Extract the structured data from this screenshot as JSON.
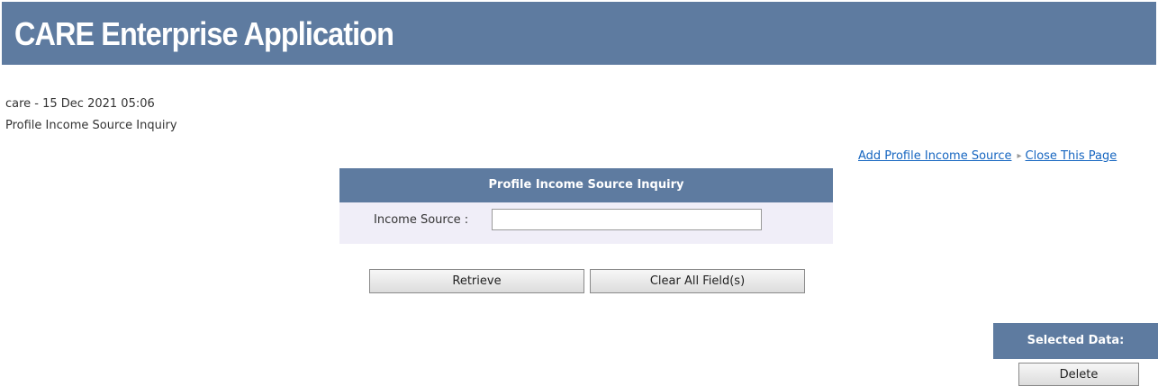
{
  "header": {
    "title": "CARE Enterprise Application"
  },
  "meta": {
    "user_timestamp": "care - 15 Dec 2021 05:06",
    "page_title": "Profile Income Source Inquiry"
  },
  "links": {
    "add": "Add Profile Income Source",
    "separator": "▸",
    "close": "Close This Page"
  },
  "form": {
    "title": "Profile Income Source Inquiry",
    "income_source_label": "Income Source :",
    "income_source_value": "",
    "retrieve_label": "Retrieve",
    "clear_label": "Clear All Field(s)"
  },
  "selected": {
    "title": "Selected Data:",
    "delete_label": "Delete"
  },
  "colors": {
    "header_bg": "#5e7ba0",
    "form_body_bg": "#f0eef8",
    "link": "#1565c0"
  }
}
